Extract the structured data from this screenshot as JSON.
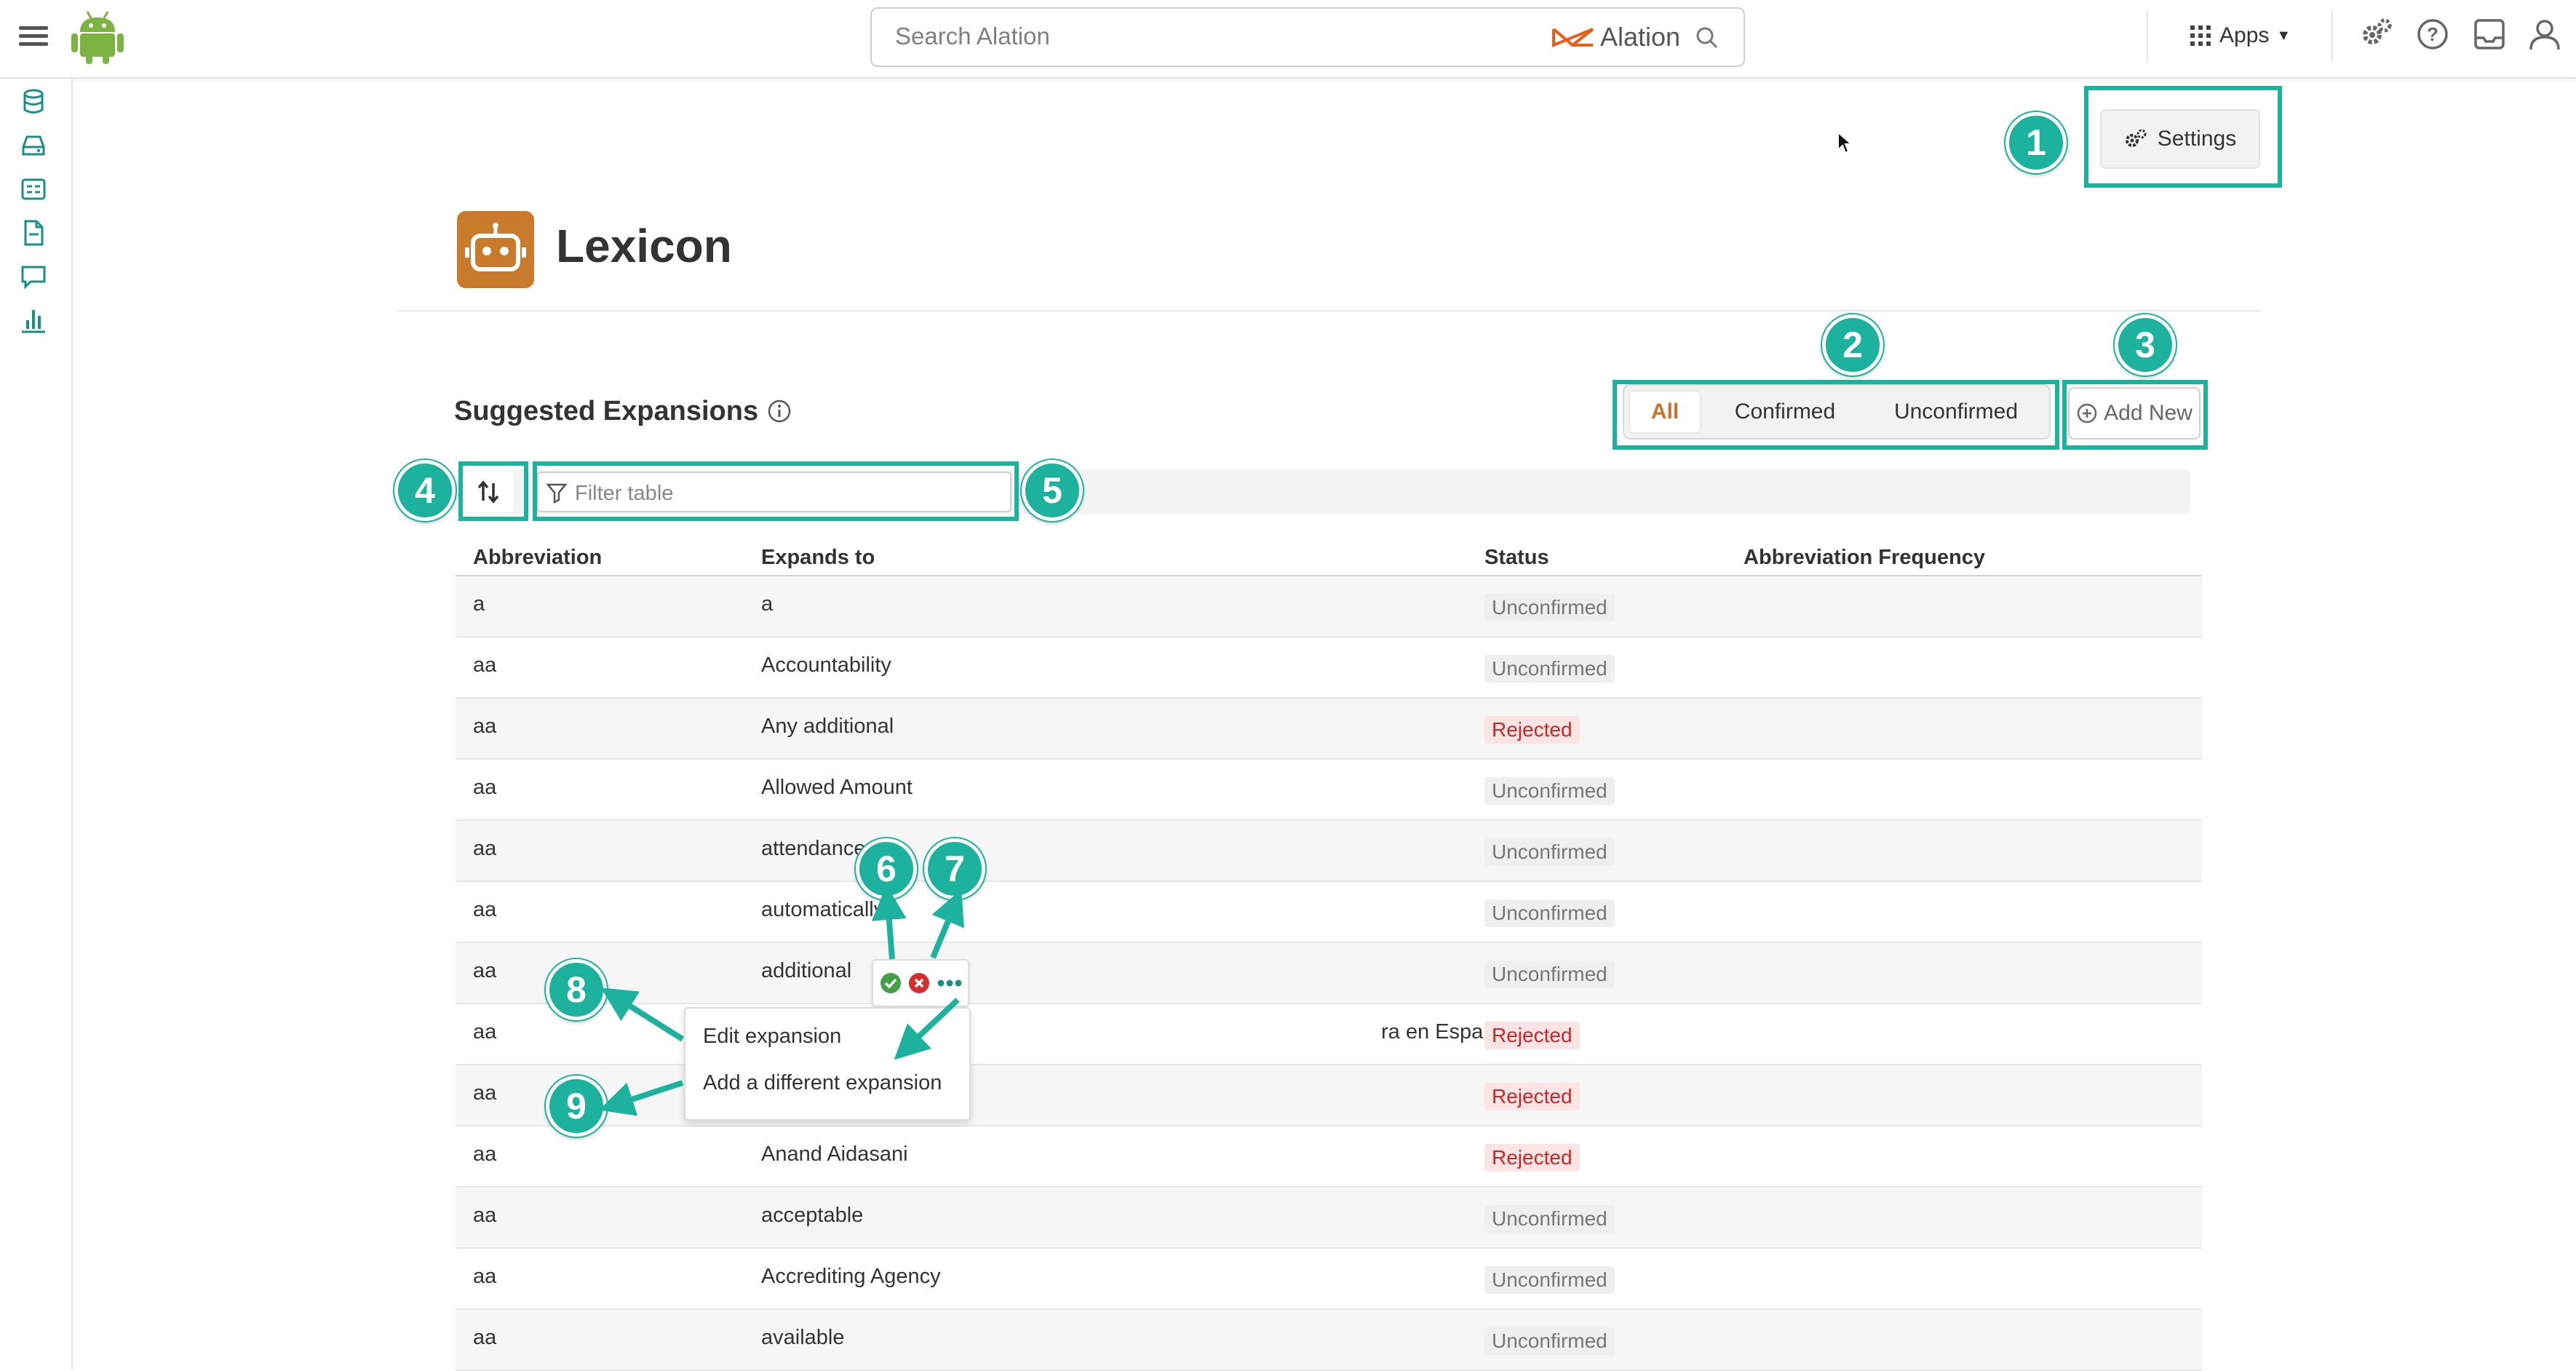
{
  "app": {
    "search_placeholder": "Search Alation",
    "brand": "Alation",
    "apps_label": "Apps"
  },
  "page": {
    "settings_label": "Settings",
    "title": "Lexicon",
    "section_title": "Suggested Expansions",
    "filter_tabs": [
      "All",
      "Confirmed",
      "Unconfirmed"
    ],
    "add_new_label": "Add New",
    "filter_placeholder": "Filter table"
  },
  "table": {
    "columns": [
      "Abbreviation",
      "Expands to",
      "Status",
      "Abbreviation Frequency"
    ],
    "rows": [
      {
        "abbr": "a",
        "expands": "a",
        "status": "Unconfirmed"
      },
      {
        "abbr": "aa",
        "expands": "Accountability",
        "status": "Unconfirmed"
      },
      {
        "abbr": "aa",
        "expands": "Any additional",
        "status": "Rejected"
      },
      {
        "abbr": "aa",
        "expands": "Allowed Amount",
        "status": "Unconfirmed"
      },
      {
        "abbr": "aa",
        "expands": "attendance",
        "status": "Unconfirmed"
      },
      {
        "abbr": "aa",
        "expands": "automatically",
        "status": "Unconfirmed"
      },
      {
        "abbr": "aa",
        "expands": "additional",
        "status": "Unconfirmed"
      },
      {
        "abbr": "aa",
        "expands": "ra en Español",
        "status": "Rejected"
      },
      {
        "abbr": "aa",
        "expands": "",
        "status": "Rejected"
      },
      {
        "abbr": "aa",
        "expands": "Anand Aidasani",
        "status": "Rejected"
      },
      {
        "abbr": "aa",
        "expands": "acceptable",
        "status": "Unconfirmed"
      },
      {
        "abbr": "aa",
        "expands": "Accrediting Agency",
        "status": "Unconfirmed"
      },
      {
        "abbr": "aa",
        "expands": "available",
        "status": "Unconfirmed"
      }
    ]
  },
  "context_menu": {
    "items": [
      "Edit expansion",
      "Add a different expansion"
    ]
  },
  "callouts": [
    "1",
    "2",
    "3",
    "4",
    "5",
    "6",
    "7",
    "8",
    "9"
  ],
  "colors": {
    "accent": "#1db29d",
    "brand_orange": "#c97a2a",
    "rejected": "#c62828",
    "nav_icon": "#1a8f87"
  },
  "icons": [
    "hamburger-icon",
    "android-logo-icon",
    "search-icon",
    "apps-grid-icon",
    "admin-gear-icon",
    "help-icon",
    "inbox-icon",
    "user-icon",
    "database-icon",
    "drive-icon",
    "catalog-icon",
    "document-icon",
    "conversation-icon",
    "chart-icon",
    "settings-gears-icon",
    "robot-icon",
    "info-icon",
    "plus-circle-icon",
    "sort-icon",
    "filter-icon",
    "confirm-icon",
    "reject-icon",
    "more-icon"
  ]
}
